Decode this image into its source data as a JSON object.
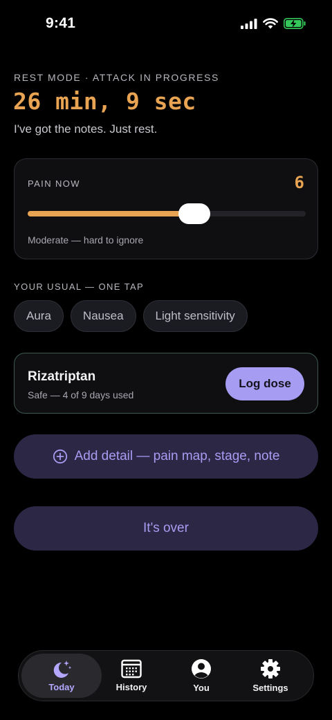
{
  "status_bar": {
    "time": "9:41"
  },
  "header": {
    "eyebrow": "REST MODE · ATTACK IN PROGRESS",
    "timer": "26 min, 9 sec",
    "subtitle": "I've got the notes. Just rest."
  },
  "pain_card": {
    "label": "PAIN NOW",
    "value": "6",
    "level_fraction": 0.6,
    "description": "Moderate — hard to ignore"
  },
  "usual": {
    "label": "YOUR USUAL — ONE TAP",
    "chips": [
      "Aura",
      "Nausea",
      "Light sensitivity"
    ]
  },
  "medication": {
    "name": "Rizatriptan",
    "status": "Safe — 4 of 9 days used",
    "button_label": "Log dose"
  },
  "actions": {
    "add_detail_label": "Add detail — pain map, stage, note",
    "its_over_label": "It's over"
  },
  "tab_bar": {
    "tabs": [
      {
        "label": "Today",
        "icon": "moon-stars-icon",
        "active": true
      },
      {
        "label": "History",
        "icon": "calendar-icon",
        "active": false
      },
      {
        "label": "You",
        "icon": "person-icon",
        "active": false
      },
      {
        "label": "Settings",
        "icon": "gear-icon",
        "active": false
      }
    ]
  },
  "colors": {
    "accent_orange": "#e8a452",
    "accent_purple": "#a69cf2",
    "button_bg": "#2c2745",
    "battery_green": "#34c759"
  }
}
